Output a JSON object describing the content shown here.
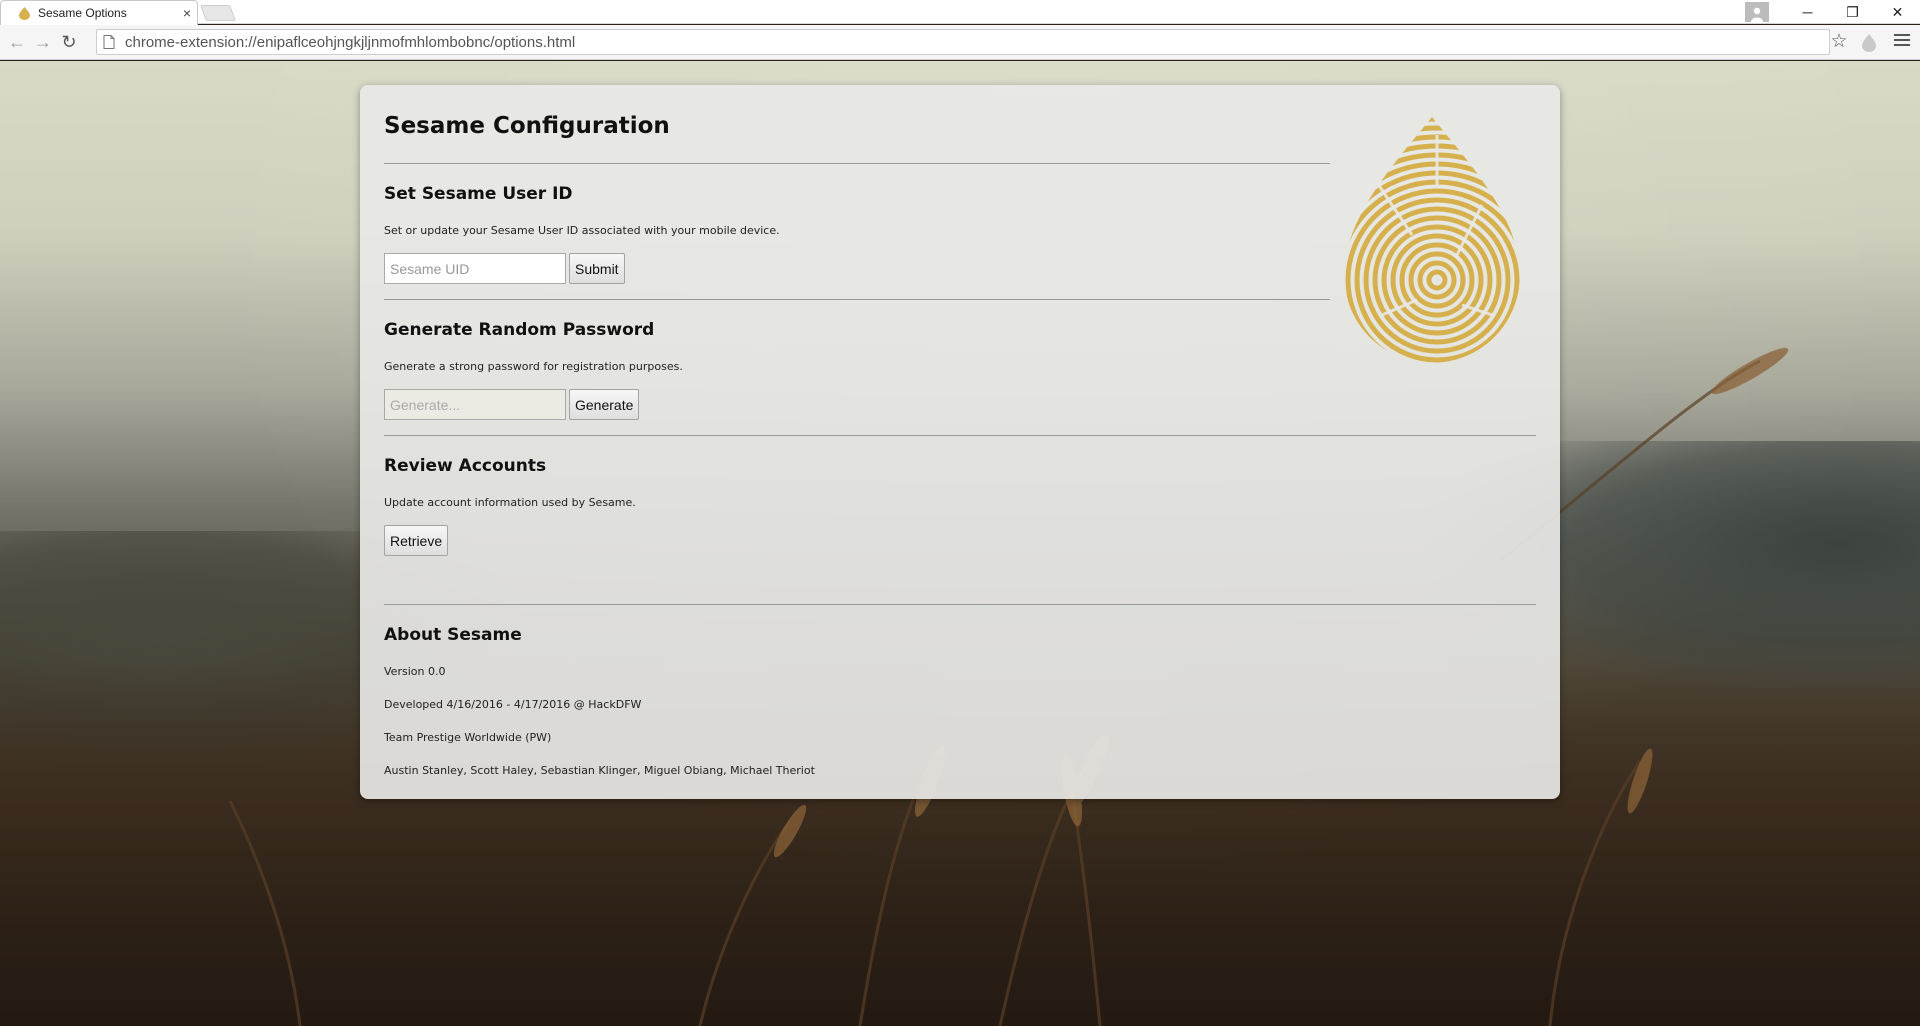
{
  "browser": {
    "tab_title": "Sesame Options",
    "tab_close": "×",
    "url": "chrome-extension://enipaflceohjngkjljnmofmhlombobnc/options.html",
    "window_controls": {
      "minimize": "─",
      "restore": "❐",
      "close": "✕"
    },
    "nav": {
      "back": "←",
      "forward": "→",
      "reload": "↻"
    },
    "star": "☆"
  },
  "page": {
    "title": "Sesame Configuration",
    "sections": {
      "uid": {
        "heading": "Set Sesame User ID",
        "description": "Set or update your Sesame User ID associated with your mobile device.",
        "input_placeholder": "Sesame UID",
        "button": "Submit"
      },
      "password": {
        "heading": "Generate Random Password",
        "description": "Generate a strong password for registration purposes.",
        "input_placeholder": "Generate...",
        "button": "Generate"
      },
      "accounts": {
        "heading": "Review Accounts",
        "description": "Update account information used by Sesame.",
        "button": "Retrieve"
      },
      "about": {
        "heading": "About Sesame",
        "version": "Version 0.0",
        "developed": "Developed 4/16/2016 - 4/17/2016 @ HackDFW",
        "team": "Team Prestige Worldwide (PW)",
        "members": "Austin Stanley, Scott Haley, Sebastian Klinger, Miguel Obiang, Michael Theriot"
      }
    }
  },
  "colors": {
    "fingerprint": "#d6b04c",
    "card_background": "#e8e8e6"
  },
  "icons": [
    "fingerprint-logo-icon",
    "page-icon",
    "star-icon",
    "menu-icon",
    "profile-icon"
  ]
}
